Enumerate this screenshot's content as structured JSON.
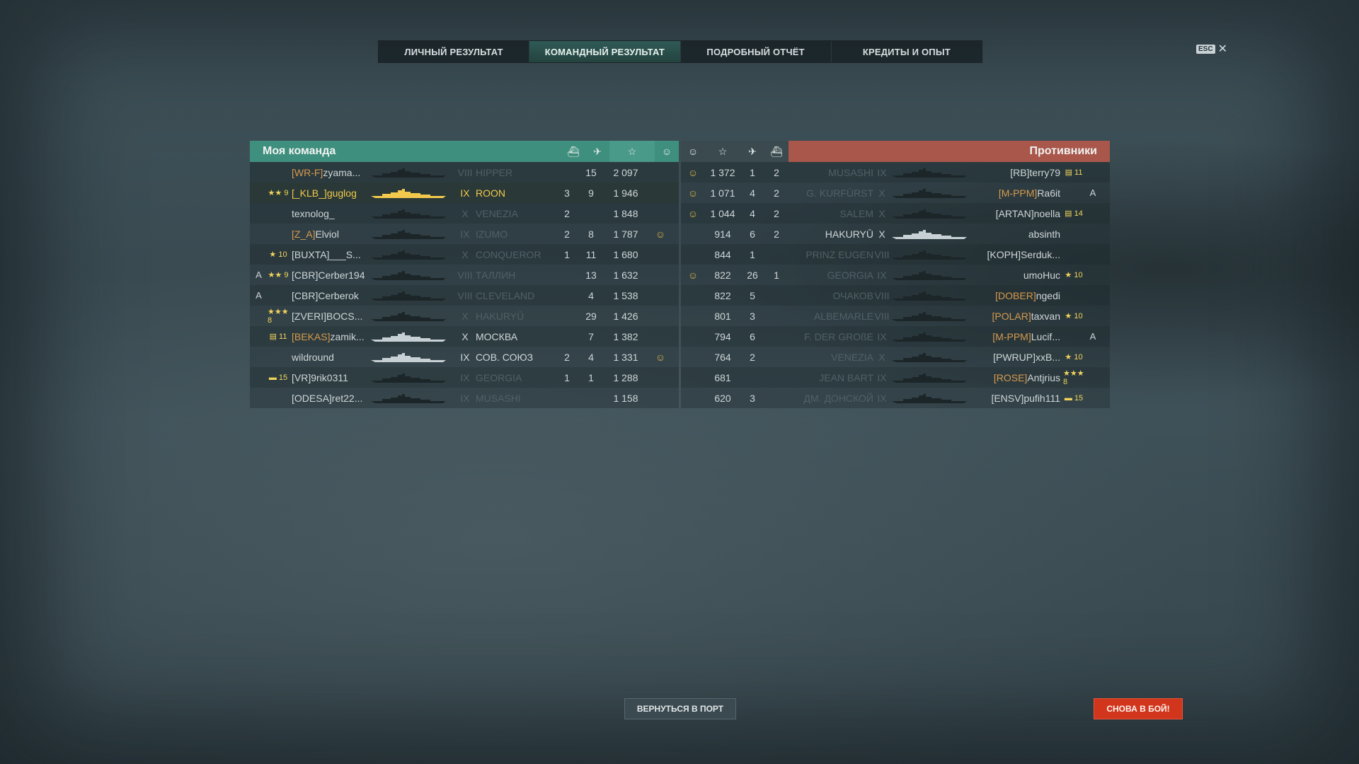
{
  "tabs": [
    {
      "label": "ЛИЧНЫЙ РЕЗУЛЬТАТ",
      "active": false
    },
    {
      "label": "КОМАНДНЫЙ РЕЗУЛЬТАТ",
      "active": true
    },
    {
      "label": "ПОДРОБНЫЙ ОТЧЁТ",
      "active": false
    },
    {
      "label": "КРЕДИТЫ И ОПЫТ",
      "active": false
    }
  ],
  "esc": {
    "key": "ESC",
    "close": "✕"
  },
  "my_team": {
    "title": "Моя команда",
    "rows": [
      {
        "badge": "",
        "rank": "",
        "clan": "[WR-F]",
        "clan_color": "orange",
        "player": "zyama...",
        "tier": "VIII",
        "ship": "HIPPER",
        "a": "",
        "b": "15",
        "c": "2 097",
        "d": "",
        "dim": true
      },
      {
        "badge": "",
        "rank": "★★ 9",
        "clan": "[_KLB_]",
        "clan_color": "gold",
        "player": "guglog",
        "tier": "IX",
        "ship": "ROON",
        "a": "3",
        "b": "9",
        "c": "1 946",
        "d": "",
        "dim": false,
        "me": true
      },
      {
        "badge": "",
        "rank": "",
        "clan": "",
        "clan_color": "",
        "player": "texnolog_",
        "tier": "X",
        "ship": "VENEZIA",
        "a": "2",
        "b": "",
        "c": "1 848",
        "d": "",
        "dim": true
      },
      {
        "badge": "",
        "rank": "",
        "clan": "[Z_A]",
        "clan_color": "orange",
        "player": "Elviol",
        "tier": "IX",
        "ship": "IZUMO",
        "a": "2",
        "b": "8",
        "c": "1 787",
        "d": "☺",
        "dim": true
      },
      {
        "badge": "",
        "rank": "★ 10",
        "clan": "[BUXTA]",
        "clan_color": "",
        "player": "___S...",
        "tier": "X",
        "ship": "CONQUEROR",
        "a": "1",
        "b": "11",
        "c": "1 680",
        "d": "",
        "dim": true
      },
      {
        "badge": "A",
        "rank": "★★ 9",
        "clan": "[CBR]",
        "clan_color": "",
        "player": "Cerber194",
        "tier": "VIII",
        "ship": "ТАЛЛИН",
        "a": "",
        "b": "13",
        "c": "1 632",
        "d": "",
        "dim": true
      },
      {
        "badge": "A",
        "rank": "",
        "clan": "[CBR]",
        "clan_color": "",
        "player": "Cerberok",
        "tier": "VIII",
        "ship": "CLEVELAND",
        "a": "",
        "b": "4",
        "c": "1 538",
        "d": "",
        "dim": true
      },
      {
        "badge": "",
        "rank": "★★★ 8",
        "clan": "[ZVERI]",
        "clan_color": "",
        "player": "BOCS...",
        "tier": "X",
        "ship": "HAKURYŪ",
        "a": "",
        "b": "29",
        "c": "1 426",
        "d": "",
        "dim": true
      },
      {
        "badge": "",
        "rank": "▤ 11",
        "clan": "[BEKAS]",
        "clan_color": "orange",
        "player": "zamik...",
        "tier": "X",
        "ship": "МОСКВА",
        "a": "",
        "b": "7",
        "c": "1 382",
        "d": "",
        "dim": false
      },
      {
        "badge": "",
        "rank": "",
        "clan": "",
        "clan_color": "",
        "player": "wildround",
        "tier": "IX",
        "ship": "СОВ. СОЮЗ",
        "a": "2",
        "b": "4",
        "c": "1 331",
        "d": "☺",
        "dim": false
      },
      {
        "badge": "",
        "rank": "▬ 15",
        "clan": "[VR]",
        "clan_color": "",
        "player": "9rik0311",
        "tier": "IX",
        "ship": "GEORGIA",
        "a": "1",
        "b": "1",
        "c": "1 288",
        "d": "",
        "dim": true
      },
      {
        "badge": "",
        "rank": "",
        "clan": "[ODESA]",
        "clan_color": "",
        "player": "ret22...",
        "tier": "IX",
        "ship": "MUSASHI",
        "a": "",
        "b": "",
        "c": "1 158",
        "d": "",
        "dim": true
      }
    ]
  },
  "enemies": {
    "title": "Противники",
    "rows": [
      {
        "d": "☺",
        "c": "1 372",
        "b": "1",
        "a": "2",
        "ship": "MUSASHI",
        "tier": "IX",
        "clan": "[RB]",
        "clan_color": "",
        "player": "terry79",
        "rank": "▤ 11",
        "badge": "",
        "dim": true
      },
      {
        "d": "☺",
        "c": "1 071",
        "b": "4",
        "a": "2",
        "ship": "G. KURFÜRST",
        "tier": "X",
        "clan": "[M-PPM]",
        "clan_color": "orange",
        "player": "Ra6it",
        "rank": "",
        "badge": "A",
        "dim": true
      },
      {
        "d": "☺",
        "c": "1 044",
        "b": "4",
        "a": "2",
        "ship": "SALEM",
        "tier": "X",
        "clan": "[ARTAN]",
        "clan_color": "",
        "player": "noella",
        "rank": "▤ 14",
        "badge": "",
        "dim": true
      },
      {
        "d": "",
        "c": "914",
        "b": "6",
        "a": "2",
        "ship": "HAKURYŪ",
        "tier": "X",
        "clan": "",
        "clan_color": "",
        "player": "absinth",
        "rank": "",
        "badge": "",
        "dim": false
      },
      {
        "d": "",
        "c": "844",
        "b": "1",
        "a": "",
        "ship": "PRINZ EUGEN",
        "tier": "VIII",
        "clan": "[KOPH]",
        "clan_color": "",
        "player": "Serduk...",
        "rank": "",
        "badge": "",
        "dim": true
      },
      {
        "d": "☺",
        "c": "822",
        "b": "26",
        "a": "1",
        "ship": "GEORGIA",
        "tier": "IX",
        "clan": "",
        "clan_color": "",
        "player": "umoHuc",
        "rank": "★ 10",
        "badge": "",
        "dim": true
      },
      {
        "d": "",
        "c": "822",
        "b": "5",
        "a": "",
        "ship": "ОЧАКОВ",
        "tier": "VIII",
        "clan": "[DOBER]",
        "clan_color": "orange",
        "player": "ngedi",
        "rank": "",
        "badge": "",
        "dim": true
      },
      {
        "d": "",
        "c": "801",
        "b": "3",
        "a": "",
        "ship": "ALBEMARLE",
        "tier": "VIII",
        "clan": "[POLAR]",
        "clan_color": "orange",
        "player": "taxvan",
        "rank": "★ 10",
        "badge": "",
        "dim": true
      },
      {
        "d": "",
        "c": "794",
        "b": "6",
        "a": "",
        "ship": "F. DER GROßE",
        "tier": "IX",
        "clan": "[M-PPM]",
        "clan_color": "orange",
        "player": "Lucif...",
        "rank": "",
        "badge": "A",
        "dim": true
      },
      {
        "d": "",
        "c": "764",
        "b": "2",
        "a": "",
        "ship": "VENEZIA",
        "tier": "X",
        "clan": "[PWRUP]",
        "clan_color": "",
        "player": "xxB...",
        "rank": "★ 10",
        "badge": "",
        "dim": true
      },
      {
        "d": "",
        "c": "681",
        "b": "",
        "a": "",
        "ship": "JEAN BART",
        "tier": "IX",
        "clan": "[ROSE]",
        "clan_color": "orange",
        "player": "Antjrius",
        "rank": "★★★ 8",
        "badge": "",
        "dim": true
      },
      {
        "d": "",
        "c": "620",
        "b": "3",
        "a": "",
        "ship": "ДМ. ДОНСКОЙ",
        "tier": "IX",
        "clan": "[ENSV]",
        "clan_color": "",
        "player": "pufih111",
        "rank": "▬ 15",
        "badge": "",
        "dim": true
      }
    ]
  },
  "header_icons": {
    "ships_destroyed": "ship-kill-icon",
    "planes_destroyed": "plane-kill-icon",
    "base_xp": "star-icon",
    "achievement": "laurel-icon"
  },
  "buttons": {
    "return_port": "ВЕРНУТЬСЯ В ПОРТ",
    "battle_again": "СНОВА В БОЙ!"
  },
  "colors": {
    "my_team": "#3f8f7e",
    "enemies": "#a9574b",
    "gold": "#f2c94c",
    "battle_btn": "#d1361d"
  }
}
